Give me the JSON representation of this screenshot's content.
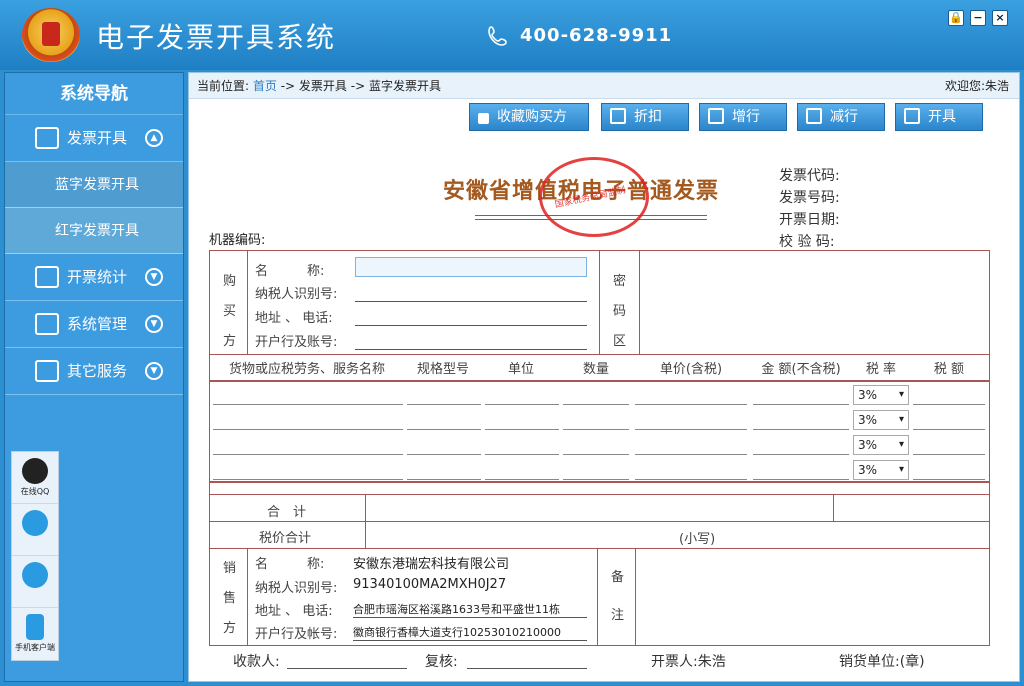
{
  "app": {
    "title": "电子发票开具系统",
    "phone": "400-628-9911"
  },
  "window": {
    "lock": "🔒",
    "min": "−",
    "close": "×"
  },
  "sidebar": {
    "title": "系统导航",
    "items": [
      {
        "label": "发票开具",
        "arrow": "▲"
      },
      {
        "label": "开票统计",
        "arrow": "▼"
      },
      {
        "label": "系统管理",
        "arrow": "▼"
      },
      {
        "label": "其它服务",
        "arrow": "▼"
      }
    ],
    "subitems": [
      "蓝字发票开具",
      "红字发票开具"
    ],
    "tools": [
      {
        "label": "在线QQ",
        "icon": "qq-icon"
      },
      {
        "label": "",
        "icon": "wechat-icon"
      },
      {
        "label": "",
        "icon": "telephone-icon"
      },
      {
        "label": "手机客户端",
        "icon": "mobile-icon"
      }
    ]
  },
  "breadcrumb": {
    "prefix": "当前位置:",
    "home": "首页",
    "step1": "-> 发票开具",
    "step2": "-> 蓝字发票开具",
    "welcome": "欢迎您:朱浩"
  },
  "toolbar": {
    "favorite": "收藏购买方",
    "discount": "折扣",
    "add_row": "增行",
    "del_row": "减行",
    "issue": "开具"
  },
  "invoice": {
    "title": "安徽省增值税电子普通发票",
    "stamp": "国家税务总局监制",
    "code_label": "发票代码:",
    "number_label": "发票号码:",
    "date_label": "开票日期:",
    "check_label": "校 验 码:",
    "machine_label": "机器编码:",
    "buyer_side": [
      "购",
      "买",
      "方"
    ],
    "buyer": {
      "name": "名　　　称:",
      "tax_id": "纳税人识别号:",
      "addr": "地址 、 电话:",
      "bank": "开户行及账号:"
    },
    "cipher": [
      "密",
      "码",
      "区"
    ],
    "columns": [
      "货物或应税劳务、服务名称",
      "规格型号",
      "单位",
      "数量",
      "单价(含税)",
      "金 额(不含税)",
      "税 率",
      "税 额"
    ],
    "rates": [
      "3%",
      "3%",
      "3%",
      "3%"
    ],
    "total_label": "合　计",
    "total_tax_label": "税价合计",
    "lower_case": "(小写)",
    "seller_side": [
      "销",
      "售",
      "方"
    ],
    "seller": {
      "name_label": "名　　　称:",
      "name": "安徽东港瑞宏科技有限公司",
      "tax_label": "纳税人识别号:",
      "tax": "91340100MA2MXH0J27",
      "addr_label": "地址 、 电话:",
      "addr": "合肥市瑶海区裕溪路1633号和平盛世11栋",
      "bank_label": "开户行及帐号:",
      "bank": "徽商银行香樟大道支行10253010210000"
    },
    "remark": [
      "备",
      "注"
    ],
    "payee": "收款人:",
    "reviewer": "复核:",
    "drawer": "开票人:朱浩",
    "seller_unit": "销货单位:(章)"
  }
}
